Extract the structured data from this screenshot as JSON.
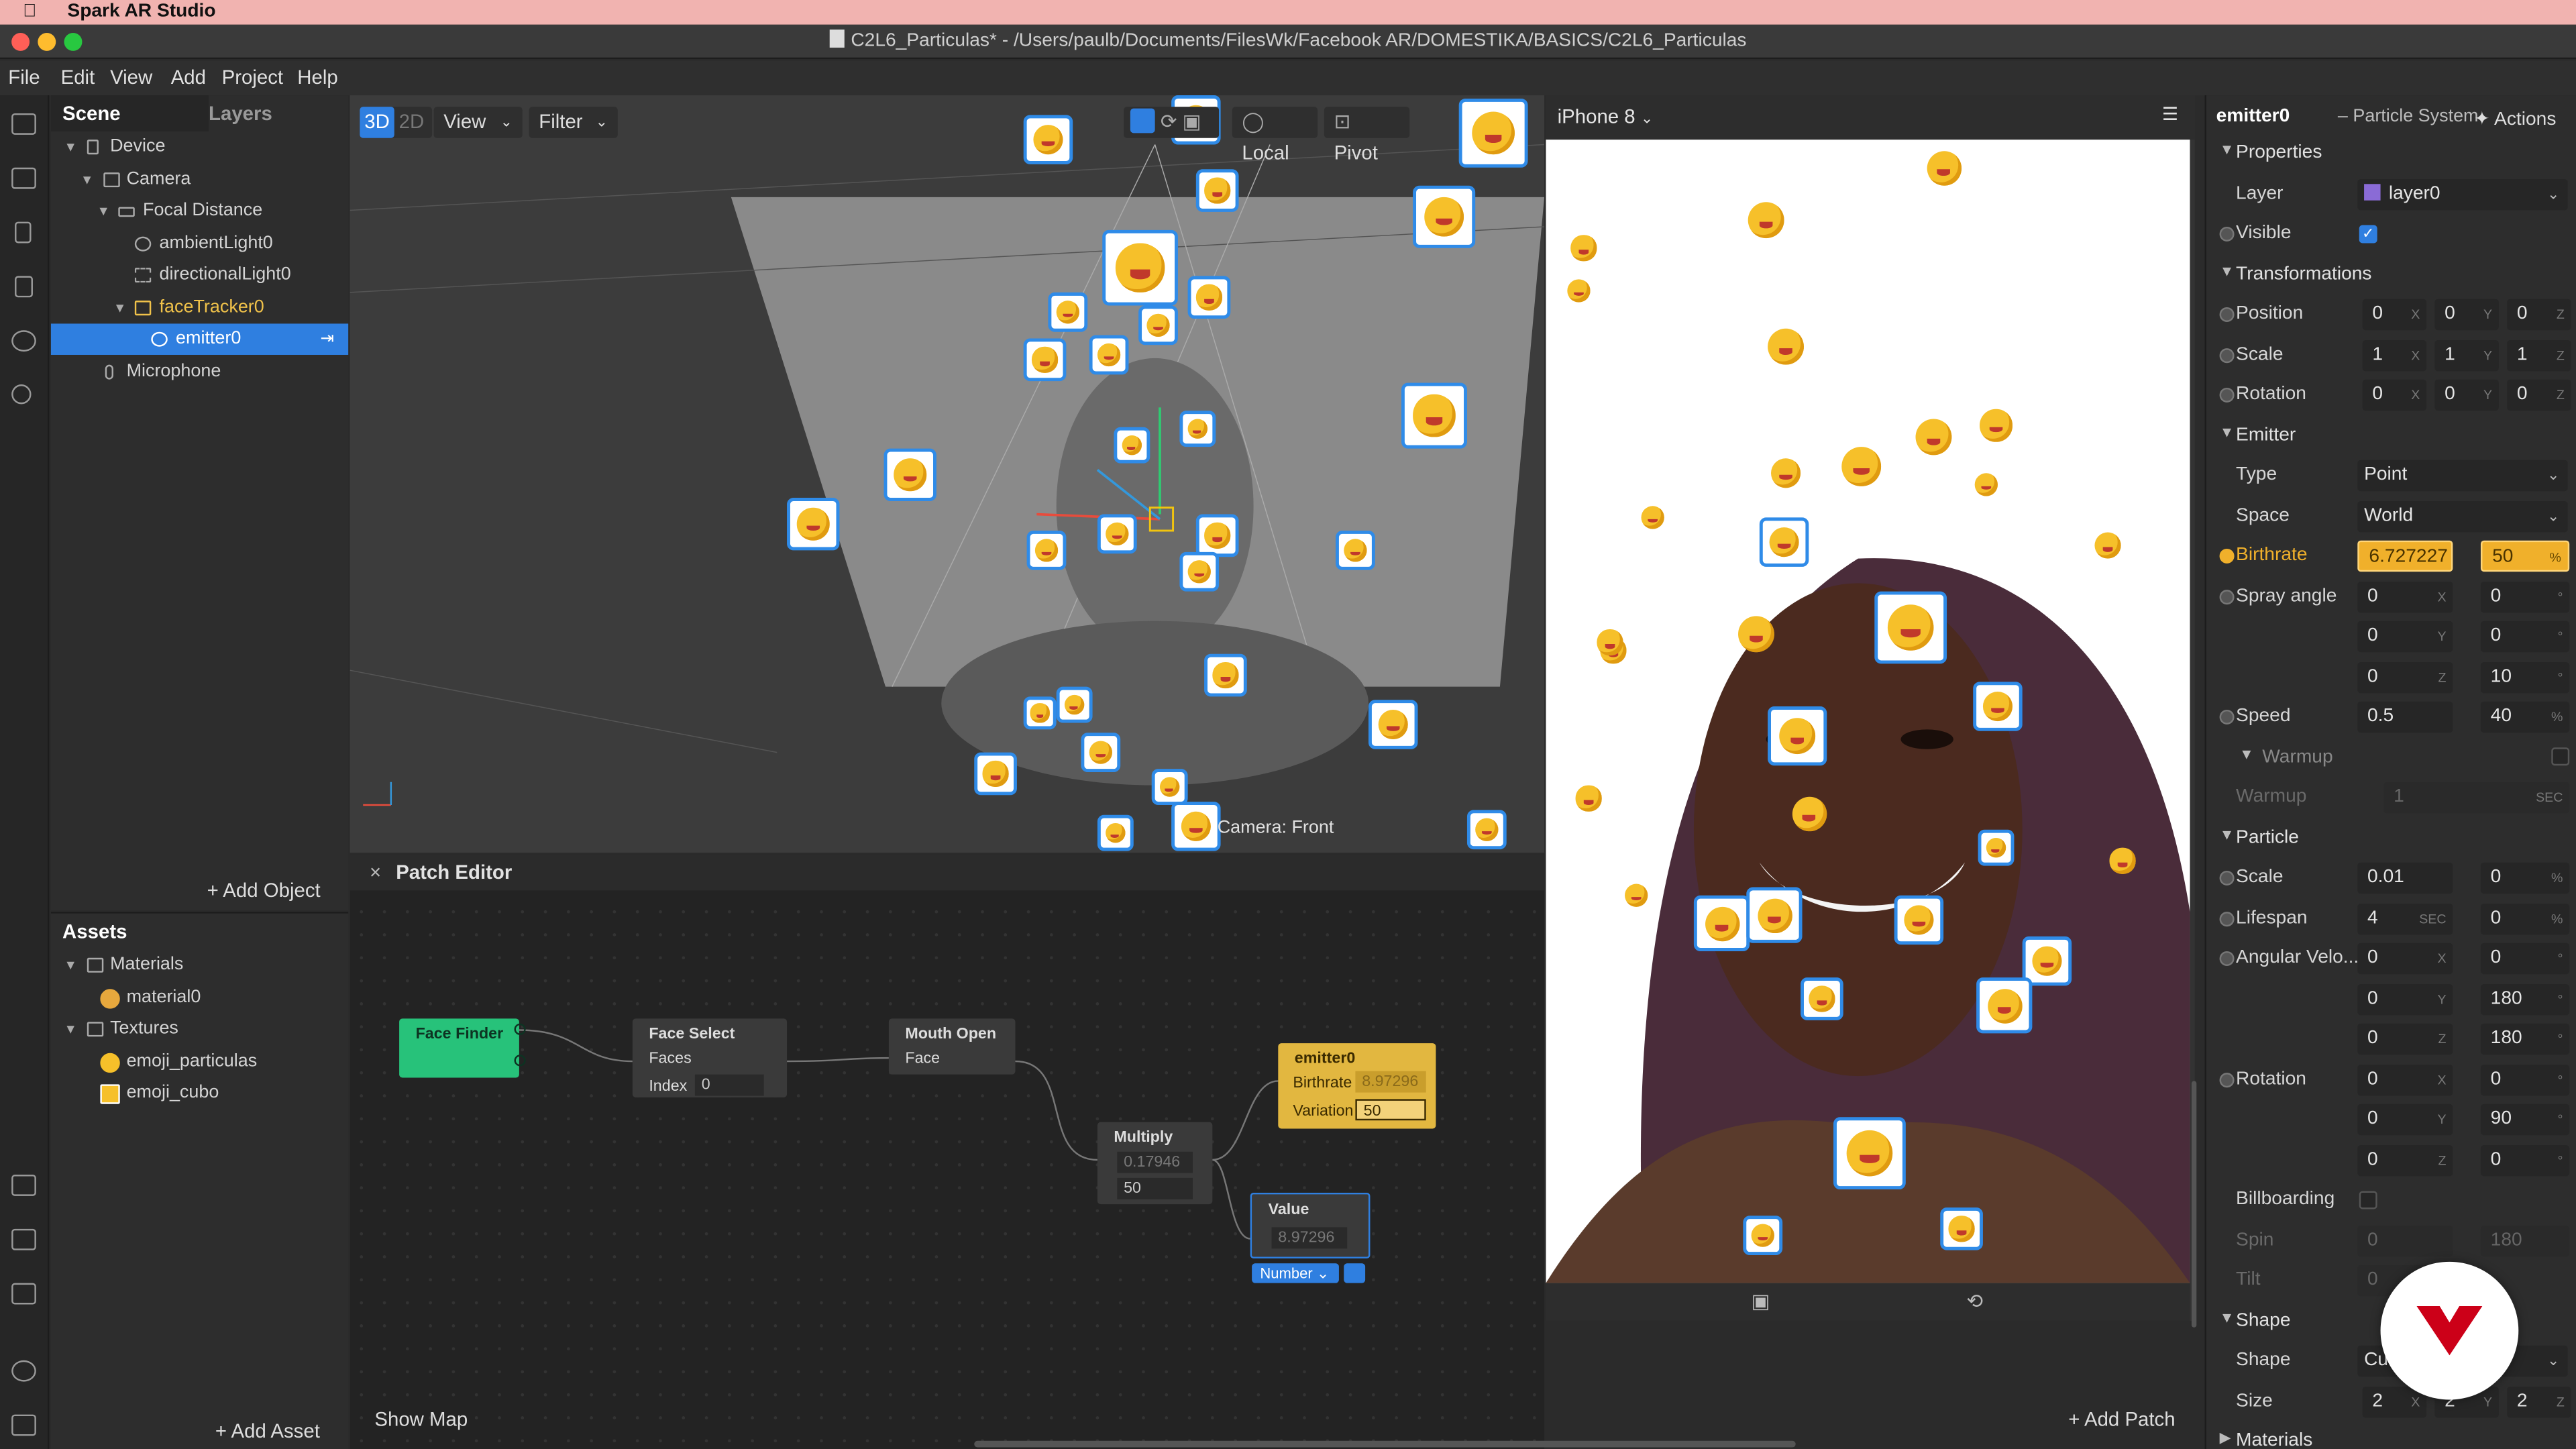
{
  "app": {
    "name": "Spark AR Studio"
  },
  "window": {
    "title": "C2L6_Particulas* - /Users/paulb/Documents/FilesWk/Facebook AR/DOMESTIKA/BASICS/C2L6_Particulas"
  },
  "menu": [
    "File",
    "Edit",
    "View",
    "Add",
    "Project",
    "Help"
  ],
  "scene": {
    "tabs": [
      "Scene",
      "Layers"
    ],
    "tree": [
      {
        "label": "Device",
        "icon": "device-icon"
      },
      {
        "label": "Camera",
        "icon": "camera-icon"
      },
      {
        "label": "Focal Distance",
        "icon": "focal-distance-icon"
      },
      {
        "label": "ambientLight0",
        "icon": "ambient-light-icon"
      },
      {
        "label": "directionalLight0",
        "icon": "directional-light-icon"
      },
      {
        "label": "faceTracker0",
        "icon": "face-tracker-icon"
      },
      {
        "label": "emitter0",
        "icon": "emitter-icon"
      },
      {
        "label": "Microphone",
        "icon": "microphone-icon"
      }
    ],
    "add_object": "Add Object"
  },
  "assets": {
    "title": "Assets",
    "items": [
      {
        "label": "Materials"
      },
      {
        "label": "material0"
      },
      {
        "label": "Textures"
      },
      {
        "label": "emoji_particulas"
      },
      {
        "label": "emoji_cubo"
      }
    ],
    "add_asset": "Add Asset"
  },
  "viewport": {
    "mode_3d": "3D",
    "mode_2d": "2D",
    "view": "View",
    "filter": "Filter",
    "local": "Local",
    "pivot": "Pivot",
    "camera_label": "Camera: Front"
  },
  "patch_editor": {
    "title": "Patch Editor",
    "show_map": "Show Map",
    "add_patch": "Add Patch",
    "nodes": {
      "face_finder": {
        "title": "Face Finder"
      },
      "face_select": {
        "title": "Face Select",
        "port_faces": "Faces",
        "port_index": "Index",
        "index_value": "0"
      },
      "mouth_open": {
        "title": "Mouth Open",
        "port_face": "Face"
      },
      "multiply": {
        "title": "Multiply",
        "in1": "0.17946",
        "in2": "50"
      },
      "emitter": {
        "title": "emitter0",
        "birthrate": "Birthrate",
        "birthrate_value": "8.97296",
        "variation": "Variation",
        "variation_value": "50"
      },
      "value": {
        "title": "Value",
        "value": "8.97296",
        "type": "Number"
      }
    }
  },
  "preview": {
    "device": "iPhone 8"
  },
  "inspector": {
    "object": "emitter0",
    "object_type": "– Particle System",
    "actions": "Actions",
    "properties": {
      "title": "Properties",
      "layer_label": "Layer",
      "layer_value": "layer0",
      "visible_label": "Visible",
      "visible_checked": true
    },
    "transformations": {
      "title": "Transformations",
      "position": {
        "label": "Position",
        "x": "0",
        "y": "0",
        "z": "0"
      },
      "scale": {
        "label": "Scale",
        "x": "1",
        "y": "1",
        "z": "1"
      },
      "rotation": {
        "label": "Rotation",
        "x": "0",
        "y": "0",
        "z": "0"
      }
    },
    "emitter": {
      "title": "Emitter",
      "type_label": "Type",
      "type_value": "Point",
      "space_label": "Space",
      "space_value": "World",
      "birthrate_label": "Birthrate",
      "birthrate_value": "6.727227",
      "birthrate_pct": "50",
      "spray_label": "Spray angle",
      "spray_x": "0",
      "spray_x2": "0",
      "spray_y": "0",
      "spray_y2": "0",
      "spray_z": "0",
      "spray_z2": "10",
      "speed_label": "Speed",
      "speed_value": "0.5",
      "speed_pct": "40",
      "warmup_title": "Warmup",
      "warmup_label": "Warmup",
      "warmup_value": "1",
      "warmup_unit": "SEC"
    },
    "particle": {
      "title": "Particle",
      "scale_label": "Scale",
      "scale_value": "0.01",
      "scale_pct": "0",
      "lifespan_label": "Lifespan",
      "lifespan_value": "4",
      "lifespan_unit": "SEC",
      "lifespan_pct": "0",
      "angvel_label": "Angular Velo...",
      "av_x": "0",
      "av_x2": "0",
      "av_y": "0",
      "av_y2": "180",
      "av_z": "0",
      "av_z2": "180",
      "rotation_label": "Rotation",
      "rot_x": "0",
      "rot_x2": "0",
      "rot_y": "0",
      "rot_y2": "90",
      "rot_z": "0",
      "rot_z2": "0",
      "billboarding_label": "Billboarding",
      "spin_label": "Spin",
      "spin_value": "0",
      "spin_value2": "180",
      "tilt_label": "Tilt",
      "tilt_value": "0"
    },
    "shape": {
      "title": "Shape",
      "shape_label": "Shape",
      "shape_value": "Cu",
      "size_label": "Size",
      "size_x": "2",
      "size_y": "2",
      "size_z": "2"
    },
    "materials": {
      "title": "Materials"
    },
    "units": {
      "pct": "%"
    }
  },
  "colors": {
    "selection": "#2f7fe0",
    "face_finder": "#27c27a",
    "emitter_node": "#e2b740",
    "mac_bar": "#f1b3b0",
    "brand_badge": "#cc0018"
  }
}
